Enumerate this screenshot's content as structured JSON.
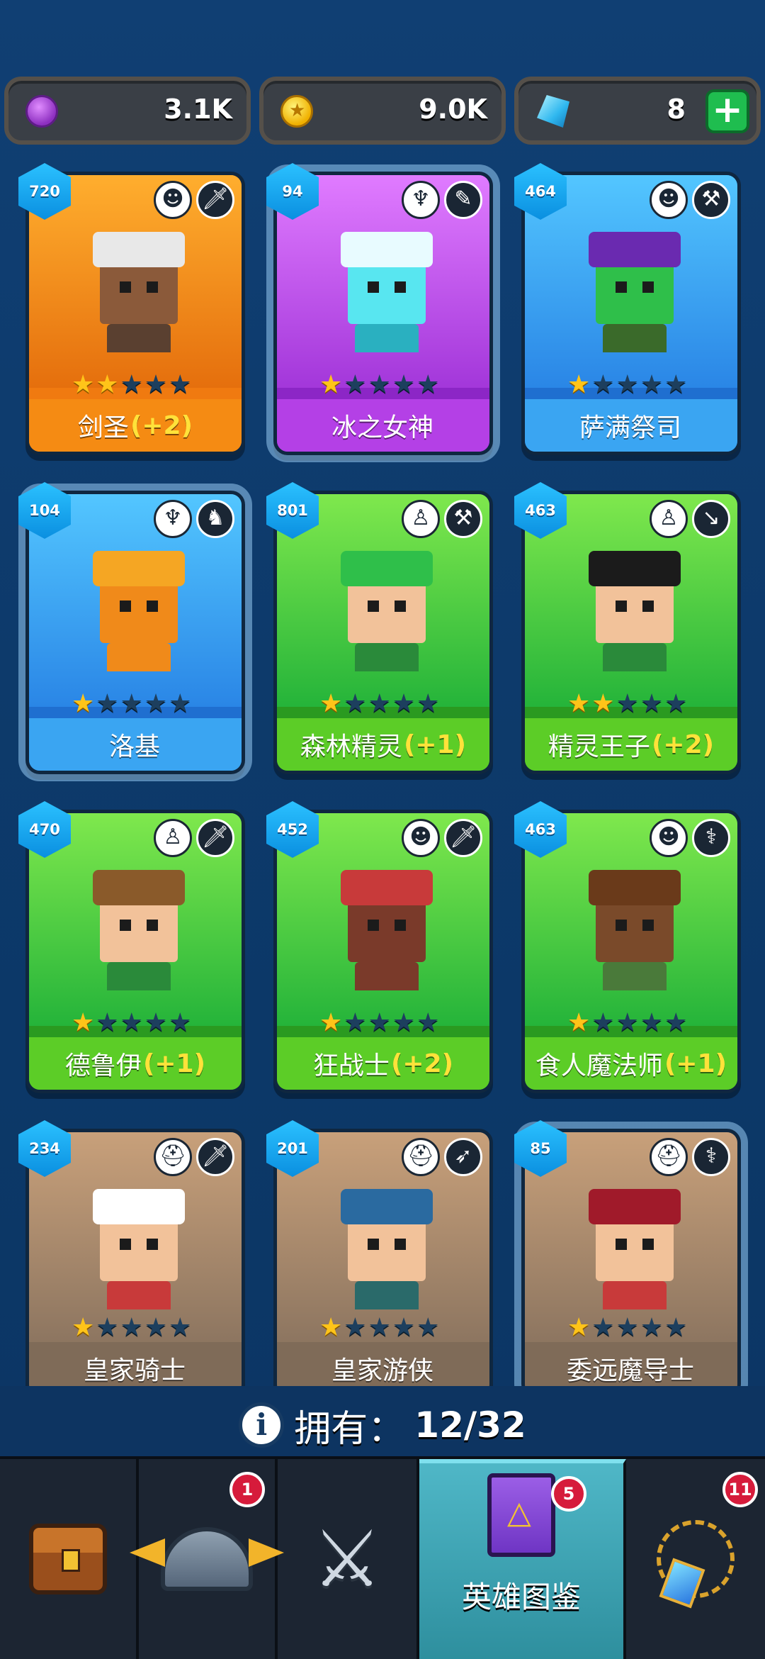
{
  "currencies": [
    {
      "name": "purple-coin",
      "amount": "3.1K"
    },
    {
      "name": "gold-coin",
      "amount": "9.0K"
    },
    {
      "name": "gems",
      "amount": "8"
    }
  ],
  "heroes": [
    {
      "level": "720",
      "name": "剑圣",
      "bonus": "(+2)",
      "stars": 2,
      "theme": "orange",
      "role_icon": "orc-icon",
      "weapon_icon": "sword-icon"
    },
    {
      "level": "94",
      "name": "冰之女神",
      "bonus": "",
      "stars": 1,
      "theme": "purple",
      "role_icon": "angel-icon",
      "weapon_icon": "wand-icon"
    },
    {
      "level": "464",
      "name": "萨满祭司",
      "bonus": "",
      "stars": 1,
      "theme": "blue",
      "role_icon": "orc-icon",
      "weapon_icon": "hammer-icon"
    },
    {
      "level": "104",
      "name": "洛基",
      "bonus": "",
      "stars": 1,
      "theme": "blue",
      "role_icon": "angel-icon",
      "weapon_icon": "dragon-icon"
    },
    {
      "level": "801",
      "name": "森林精灵",
      "bonus": "(+1)",
      "stars": 1,
      "theme": "green",
      "role_icon": "elf-icon",
      "weapon_icon": "hammer-icon"
    },
    {
      "level": "463",
      "name": "精灵王子",
      "bonus": "(+2)",
      "stars": 2,
      "theme": "green",
      "role_icon": "elf-icon",
      "weapon_icon": "dagger-icon"
    },
    {
      "level": "470",
      "name": "德鲁伊",
      "bonus": "(+1)",
      "stars": 1,
      "theme": "green",
      "role_icon": "elf-icon",
      "weapon_icon": "sword-icon"
    },
    {
      "level": "452",
      "name": "狂战士",
      "bonus": "(+2)",
      "stars": 1,
      "theme": "green",
      "role_icon": "orc-icon",
      "weapon_icon": "sword-icon"
    },
    {
      "level": "463",
      "name": "食人魔法师",
      "bonus": "(+1)",
      "stars": 1,
      "theme": "green",
      "role_icon": "orc-icon",
      "weapon_icon": "staff-icon"
    },
    {
      "level": "234",
      "name": "皇家骑士",
      "bonus": "",
      "stars": 1,
      "theme": "brown",
      "role_icon": "knight-helmet-icon",
      "weapon_icon": "sword-icon"
    },
    {
      "level": "201",
      "name": "皇家游侠",
      "bonus": "",
      "stars": 1,
      "theme": "brown",
      "role_icon": "knight-helmet-icon",
      "weapon_icon": "bow-icon"
    },
    {
      "level": "85",
      "name": "委远魔导士",
      "bonus": "",
      "stars": 1,
      "theme": "brown",
      "role_icon": "knight-helmet-icon",
      "weapon_icon": "staff-icon"
    }
  ],
  "ownership": {
    "label": "拥有：",
    "count": "12/32"
  },
  "nav": {
    "items": [
      {
        "name": "chest",
        "badge": ""
      },
      {
        "name": "heroes-helmet",
        "badge": "1"
      },
      {
        "name": "battle-swords",
        "badge": ""
      },
      {
        "name": "hero-codex",
        "label": "英雄图鉴",
        "badge": "5"
      },
      {
        "name": "amulet",
        "badge": "11"
      }
    ]
  },
  "colors": {
    "background": "#0e3b6e",
    "star_on": "#ffc419",
    "bonus": "#ffe23a",
    "badge_red": "#d61b3b",
    "active_tab": "#4fb7c7"
  }
}
